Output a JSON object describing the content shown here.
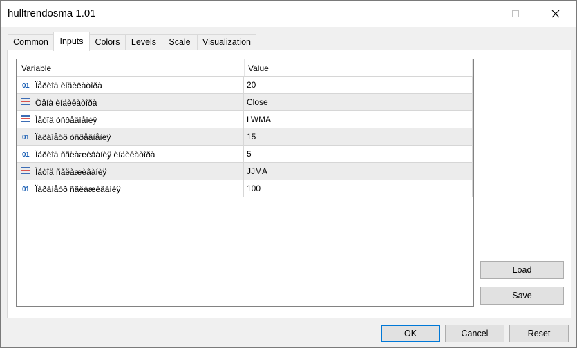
{
  "window": {
    "title": "hulltrendosma 1.01"
  },
  "tabs": [
    {
      "label": "Common"
    },
    {
      "label": "Inputs"
    },
    {
      "label": "Colors"
    },
    {
      "label": "Levels"
    },
    {
      "label": "Scale"
    },
    {
      "label": "Visualization"
    }
  ],
  "active_tab": "Inputs",
  "grid": {
    "columns": {
      "variable": "Variable",
      "value": "Value"
    },
    "rows": [
      {
        "icon": "int-icon",
        "icon_text": "01",
        "variable": "Ïåðèîä èíäèêàòîðà",
        "value": "20"
      },
      {
        "icon": "enum-icon",
        "variable": "Öåíà èíäèêàòîðà",
        "value": "Close"
      },
      {
        "icon": "enum-icon",
        "variable": "Ìåòîä óñðåäíåíèÿ",
        "value": "LWMA"
      },
      {
        "icon": "int-icon",
        "icon_text": "01",
        "variable": "Ïàðàìåòð óñðåäíåíèÿ",
        "value": "15"
      },
      {
        "icon": "int-icon",
        "icon_text": "01",
        "variable": "Ïåðèîä ñãëàæèâàíèÿ èíäèêàòîðà",
        "value": "5"
      },
      {
        "icon": "enum-icon",
        "variable": "Ìåòîä ñãëàæèâàíèÿ",
        "value": "JJMA"
      },
      {
        "icon": "int-icon",
        "icon_text": "01",
        "variable": "Ïàðàìåòð ñãëàæèâàíèÿ",
        "value": "100"
      }
    ]
  },
  "buttons": {
    "load": "Load",
    "save": "Save",
    "ok": "OK",
    "cancel": "Cancel",
    "reset": "Reset"
  },
  "colors": {
    "default_button_border": "#0078d7",
    "int_icon": "#1a5fb4",
    "enum_icon_blue": "#3d6db5",
    "enum_icon_red": "#d9534f"
  }
}
